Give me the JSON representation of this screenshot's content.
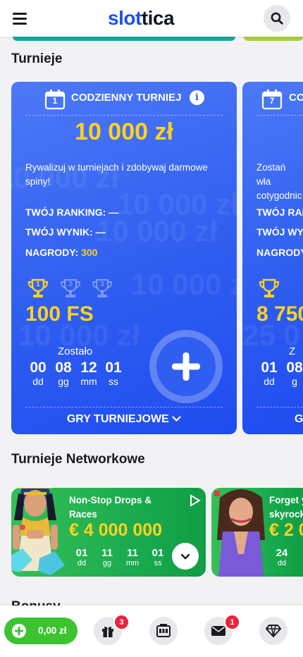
{
  "header": {
    "logo_part1": "slot",
    "logo_part2": "tica"
  },
  "sections": {
    "tournaments_title": "Turnieje",
    "network_title": "Turnieje Networkowe",
    "bonus_title": "Bonusy"
  },
  "tournaments": [
    {
      "calendar_day": "1",
      "type": "CODZIENNY TURNIEJ",
      "prize": "10 000 zł",
      "watermark": "10 000 zł",
      "description": "Rywalizuj w turniejach i zdobywaj darmowe spiny!",
      "ranking_label": "TWÓJ RANKING: —",
      "score_label": "TWÓJ WYNIK: —",
      "prizes_label": "NAGRODY:",
      "prizes_value": "300",
      "first_prize": "100 FS",
      "trophy_places": [
        "1",
        "2",
        "3"
      ],
      "remaining_label": "Zostało",
      "countdown": [
        {
          "value": "00",
          "unit": "dd"
        },
        {
          "value": "08",
          "unit": "gg"
        },
        {
          "value": "12",
          "unit": "mm"
        },
        {
          "value": "01",
          "unit": "ss"
        }
      ],
      "games_label": "GRY TURNIEJOWE"
    },
    {
      "calendar_day": "7",
      "type": "CO",
      "description": "Zostań wła cotygodnic",
      "ranking_label": "TWÓJ RAN",
      "score_label": "TWÓJ WYN",
      "prizes_label": "NAGRODY",
      "first_prize": "8 750",
      "watermark": "25 0",
      "remaining_label": "Z",
      "countdown": [
        {
          "value": "01",
          "unit": "dd"
        },
        {
          "value": "08",
          "unit": "g"
        }
      ],
      "games_label": "G"
    }
  ],
  "network": [
    {
      "title": "Non-Stop Drops & Races",
      "amount": "€ 4 000 000",
      "countdown": [
        {
          "value": "01",
          "unit": "dd"
        },
        {
          "value": "11",
          "unit": "gg"
        },
        {
          "value": "11",
          "unit": "mm"
        },
        {
          "value": "01",
          "unit": "ss"
        }
      ]
    },
    {
      "title": "Forget y skyrock",
      "amount": "€ 2 0",
      "countdown": [
        {
          "value": "24",
          "unit": "dd"
        }
      ]
    }
  ],
  "bottom_nav": {
    "balance": "0,00 zł",
    "gift_badge": "3",
    "mail_badge": "1"
  },
  "colors": {
    "brand_blue": "#1d4ff0",
    "card_blue": "#2f5ef0",
    "gold": "#ffd21f",
    "green": "#17a84d",
    "badge_red": "#e8233a"
  }
}
